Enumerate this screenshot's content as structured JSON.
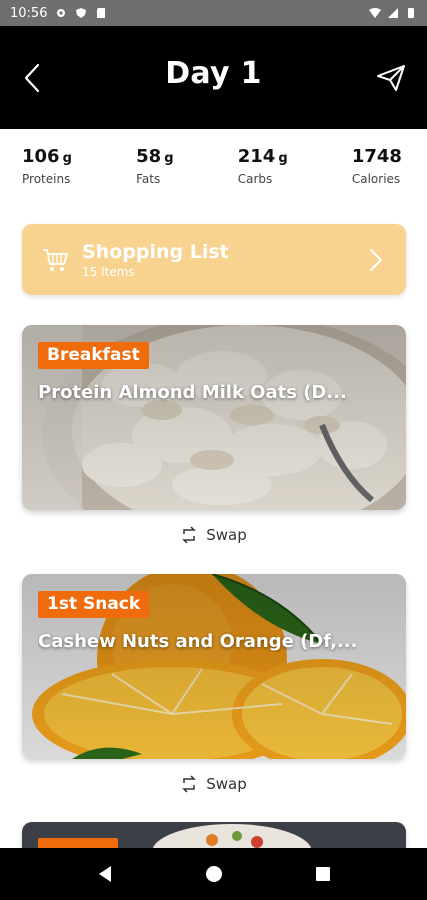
{
  "status_bar": {
    "time": "10:56"
  },
  "header": {
    "title": "Day 1"
  },
  "macros": [
    {
      "value": "106",
      "unit": "g",
      "label": "Proteins"
    },
    {
      "value": "58",
      "unit": "g",
      "label": "Fats"
    },
    {
      "value": "214",
      "unit": "g",
      "label": "Carbs"
    },
    {
      "value": "1748",
      "unit": "",
      "label": "Calories"
    }
  ],
  "shopping_list": {
    "title": "Shopping List",
    "subtitle": "15 Items"
  },
  "meals": [
    {
      "tag": "Breakfast",
      "name": "Protein Almond Milk Oats (D...",
      "swap_label": "Swap"
    },
    {
      "tag": "1st Snack",
      "name": "Cashew Nuts and Orange (Df,...",
      "swap_label": "Swap"
    }
  ],
  "colors": {
    "accent": "#f06b0c",
    "shopping_bg": "#f8d28f",
    "header_bg": "#000000"
  }
}
